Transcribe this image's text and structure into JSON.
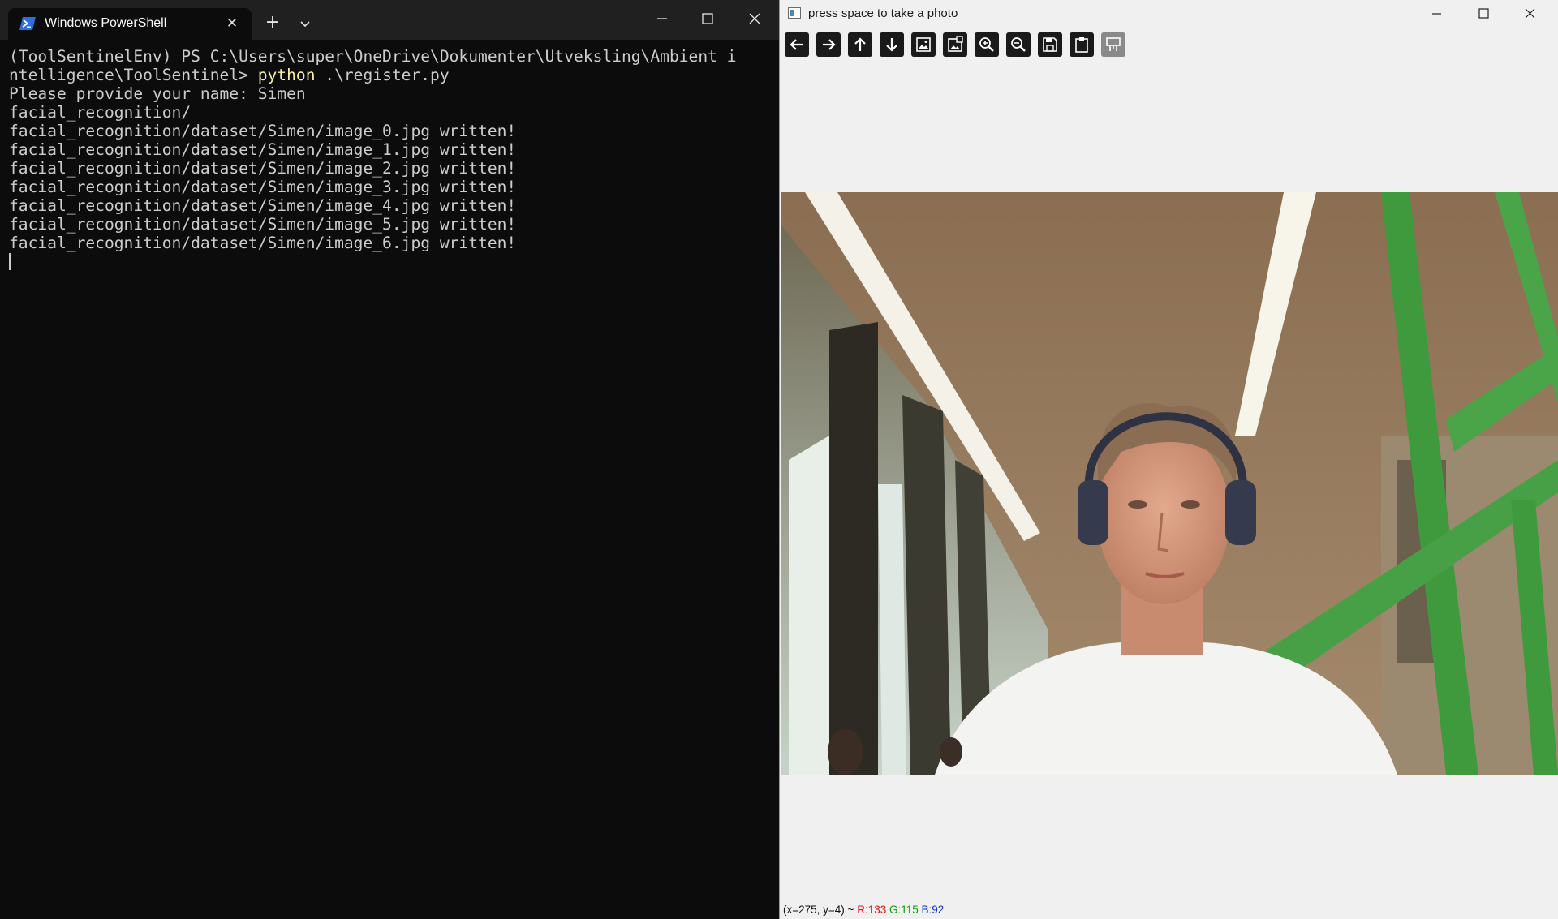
{
  "terminal": {
    "tab_title": "Windows PowerShell",
    "new_tab_label": "+",
    "lines": [
      {
        "text": "(ToolSentinelEnv) PS C:\\Users\\super\\OneDrive\\Dokumenter\\Utveksling\\Ambient i"
      },
      {
        "text": "ntelligence\\ToolSentinel> ",
        "cmd": "python",
        "args": " .\\register.py"
      },
      {
        "text": "Please provide your name: Simen"
      },
      {
        "text": "facial_recognition/"
      },
      {
        "text": "facial_recognition/dataset/Simen/image_0.jpg written!"
      },
      {
        "text": "facial_recognition/dataset/Simen/image_1.jpg written!"
      },
      {
        "text": "facial_recognition/dataset/Simen/image_2.jpg written!"
      },
      {
        "text": "facial_recognition/dataset/Simen/image_3.jpg written!"
      },
      {
        "text": "facial_recognition/dataset/Simen/image_4.jpg written!"
      },
      {
        "text": "facial_recognition/dataset/Simen/image_5.jpg written!"
      },
      {
        "text": "facial_recognition/dataset/Simen/image_6.jpg written!"
      }
    ],
    "colors": {
      "background": "#0c0c0c",
      "foreground": "#cccccc",
      "command": "#f9f1a5",
      "tabbar": "#202020"
    }
  },
  "opencv_window": {
    "title": "press space to take a photo",
    "toolbar": [
      {
        "name": "pan-left-icon"
      },
      {
        "name": "pan-right-icon"
      },
      {
        "name": "pan-up-icon"
      },
      {
        "name": "pan-down-icon"
      },
      {
        "name": "zoom-original-icon"
      },
      {
        "name": "zoom-fit-icon"
      },
      {
        "name": "zoom-in-icon"
      },
      {
        "name": "zoom-out-icon"
      },
      {
        "name": "save-icon"
      },
      {
        "name": "copy-clipboard-icon"
      },
      {
        "name": "properties-icon"
      }
    ],
    "status": {
      "coords": "(x=275, y=4) ~ ",
      "r": "R:133",
      "g": "G:115",
      "b": "B:92"
    },
    "colors": {
      "background": "#f0f0f0",
      "status_r": "#e01010",
      "status_g": "#10a010",
      "status_b": "#1030e0"
    }
  }
}
